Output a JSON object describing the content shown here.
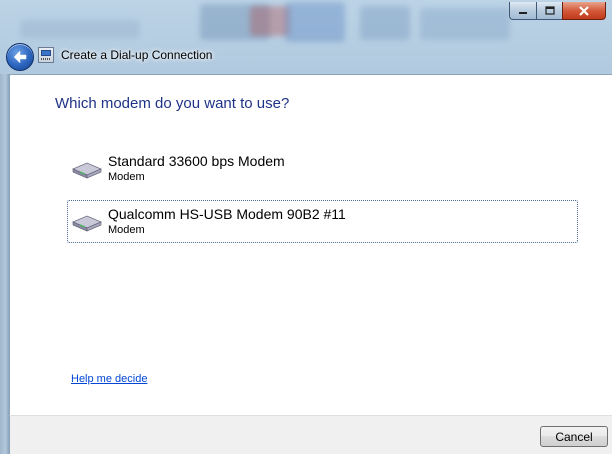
{
  "window": {
    "title": "Create a Dial-up Connection",
    "back_icon": "back-arrow-icon",
    "app_icon": "dialup-connection-icon",
    "caption_buttons": [
      "minimize-icon",
      "maximize-icon",
      "close-icon"
    ]
  },
  "page": {
    "heading": "Which modem do you want to use?",
    "modems": [
      {
        "name": "Standard 33600 bps Modem",
        "type": "Modem",
        "icon": "modem-icon",
        "selected": false
      },
      {
        "name": "Qualcomm HS-USB Modem 90B2 #11",
        "type": "Modem",
        "icon": "modem-icon",
        "selected": true
      }
    ],
    "help_link": "Help me decide"
  },
  "footer": {
    "cancel_label": "Cancel"
  },
  "colors": {
    "heading": "#1e3287",
    "link": "#0046d5",
    "content_bg": "#ffffff",
    "footer_bg": "#f0f0f0"
  }
}
